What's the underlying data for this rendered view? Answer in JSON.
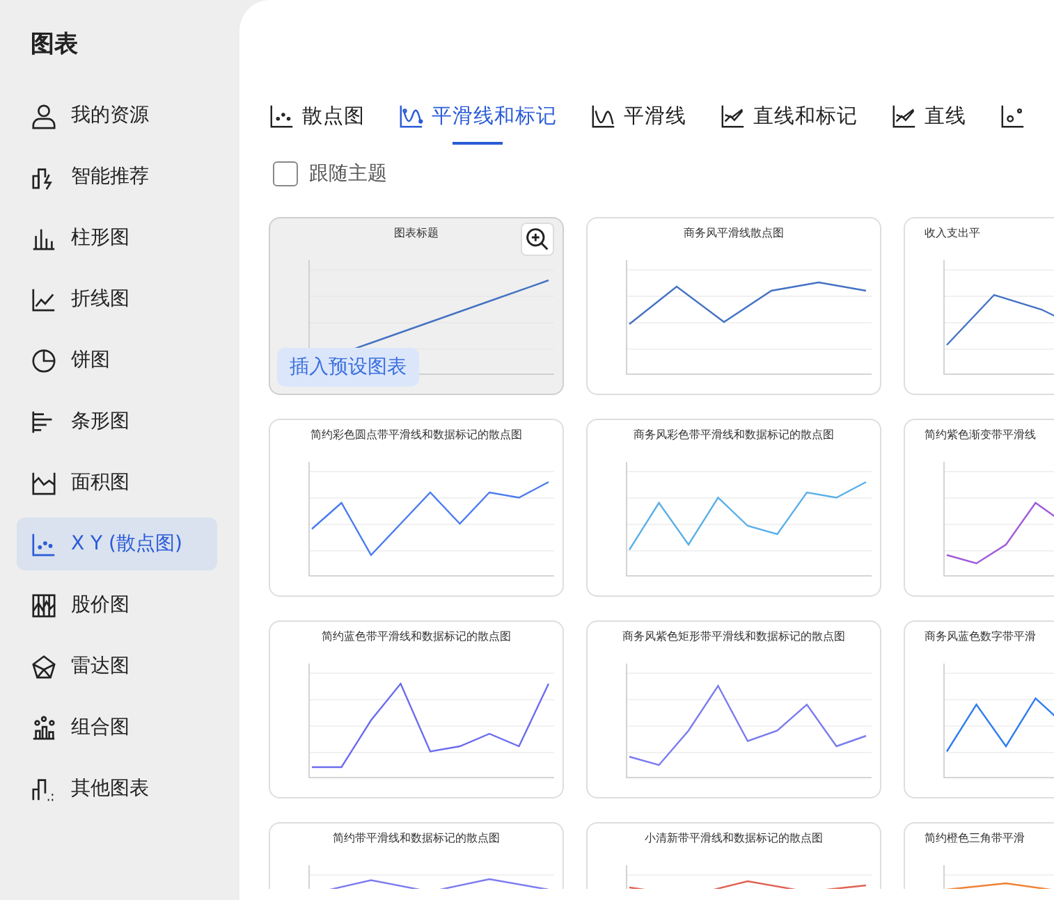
{
  "sidebar": {
    "title": "图表",
    "items": [
      {
        "label": "我的资源",
        "selected": false
      },
      {
        "label": "智能推荐",
        "selected": false
      },
      {
        "label": "柱形图",
        "selected": false
      },
      {
        "label": "折线图",
        "selected": false
      },
      {
        "label": "饼图",
        "selected": false
      },
      {
        "label": "条形图",
        "selected": false
      },
      {
        "label": "面积图",
        "selected": false
      },
      {
        "label": "X Y (散点图)",
        "selected": true
      },
      {
        "label": "股价图",
        "selected": false
      },
      {
        "label": "雷达图",
        "selected": false
      },
      {
        "label": "组合图",
        "selected": false
      },
      {
        "label": "其他图表",
        "selected": false
      }
    ]
  },
  "tabs": [
    {
      "label": "散点图",
      "selected": false
    },
    {
      "label": "平滑线和标记",
      "selected": true
    },
    {
      "label": "平滑线",
      "selected": false
    },
    {
      "label": "直线和标记",
      "selected": false
    },
    {
      "label": "直线",
      "selected": false
    },
    {
      "selected": false
    }
  ],
  "follow_theme": {
    "label": "跟随主题",
    "checked": false
  },
  "templates": [
    {
      "title": "图表标题",
      "hovered": true,
      "insert_label": "插入预设图表"
    },
    {
      "title": "商务风平滑线散点图",
      "hovered": false
    },
    {
      "title": "收入支出平",
      "hovered": false
    },
    {
      "title": "简约彩色圆点带平滑线和数据标记的散点图",
      "hovered": false
    },
    {
      "title": "商务风彩色带平滑线和数据标记的散点图",
      "hovered": false
    },
    {
      "title": "简约紫色渐变带平滑线",
      "hovered": false
    },
    {
      "title": "简约蓝色带平滑线和数据标记的散点图",
      "hovered": false
    },
    {
      "title": "商务风紫色矩形带平滑线和数据标记的散点图",
      "hovered": false
    },
    {
      "title": "商务风蓝色数字带平滑",
      "hovered": false
    },
    {
      "title": "简约带平滑线和数据标记的散点图",
      "hovered": false
    },
    {
      "title": "小清新带平滑线和数据标记的散点图",
      "hovered": false
    },
    {
      "title": "简约橙色三角带平滑",
      "hovered": false
    }
  ]
}
